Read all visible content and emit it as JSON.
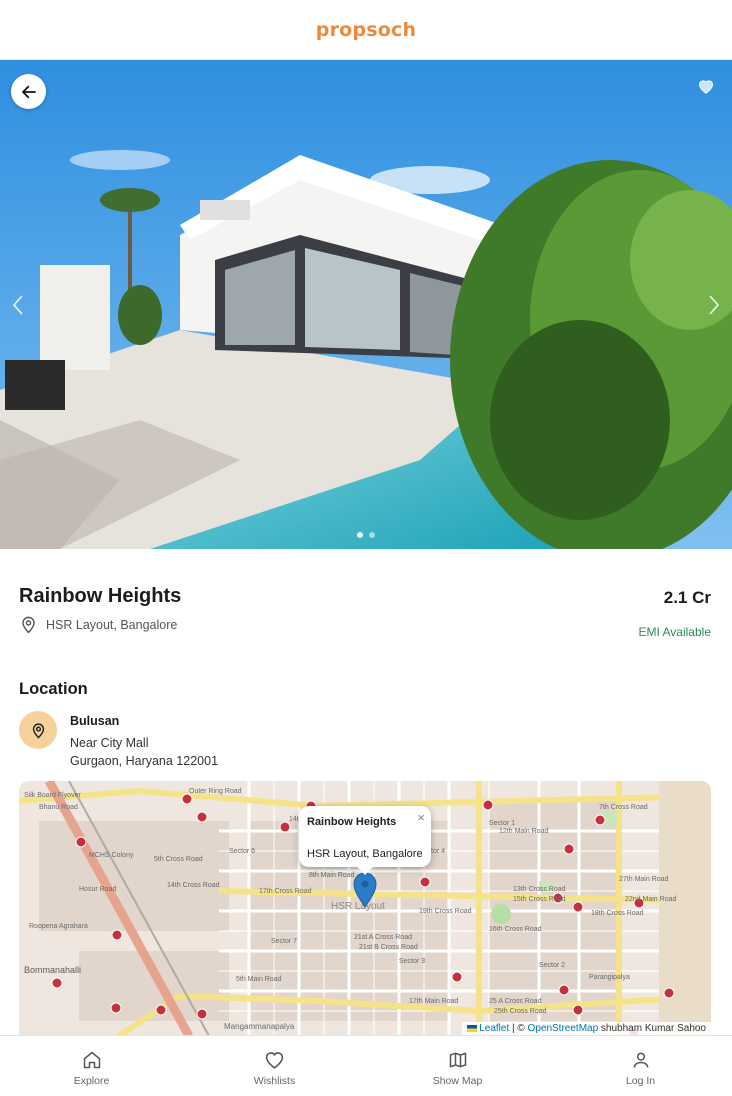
{
  "header": {
    "logo": "propsoch"
  },
  "gallery": {
    "image_count": 2,
    "active_index": 0
  },
  "property": {
    "title": "Rainbow Heights",
    "price": "2.1 Cr",
    "address": "HSR Layout, Bangalore",
    "emi": "EMI Available"
  },
  "location": {
    "section_title": "Location",
    "name": "Bulusan",
    "line1": "Near City Mall",
    "line2": "Gurgaon, Haryana 122001"
  },
  "map": {
    "popup_title": "Rainbow Heights",
    "popup_subtitle": "HSR Layout, Bangalore",
    "popup_close": "×",
    "attribution_leaflet": "Leaflet",
    "attribution_sep": " | © ",
    "attribution_osm": "OpenStreetMap",
    "attribution_author": " shubham Kumar Sahoo",
    "labels": [
      "Outer Ring Road",
      "Silk Board Flyover",
      "MCHS Colony",
      "5th Cross Road",
      "17th Cross Road",
      "HSR Layout",
      "Sector 6",
      "Sector 7",
      "Sector 3",
      "Sector 2",
      "Sector 1",
      "19th Cross Road",
      "14th Cross Road",
      "21st A Cross Road",
      "21st B Cross Road",
      "27th Main Road",
      "Roopena Agrahara",
      "Bommanahalli",
      "Mangammanapalya",
      "Parangipalya",
      "25 A Cross Road",
      "25th Cross Road",
      "14th Main Road",
      "12th Main Road",
      "18th Cross Road",
      "22nd Main Road",
      "5th Main Road",
      "17th Main Road",
      "13th Cross Road",
      "15th Cross Road",
      "16th Cross Road",
      "Hosur Road",
      "Bhanu Road",
      "7th Cross Road",
      "8th Main Road",
      "Sector 4"
    ]
  },
  "bottom_nav": [
    {
      "label": "Explore",
      "icon": "home-icon"
    },
    {
      "label": "Wishlists",
      "icon": "heart-icon"
    },
    {
      "label": "Show Map",
      "icon": "map-icon"
    },
    {
      "label": "Log In",
      "icon": "user-icon"
    }
  ],
  "colors": {
    "brand": "#f08a3a",
    "emi_green": "#2c8a57",
    "location_badge": "#f6d19b",
    "map_marker": "#2a7cc7"
  }
}
